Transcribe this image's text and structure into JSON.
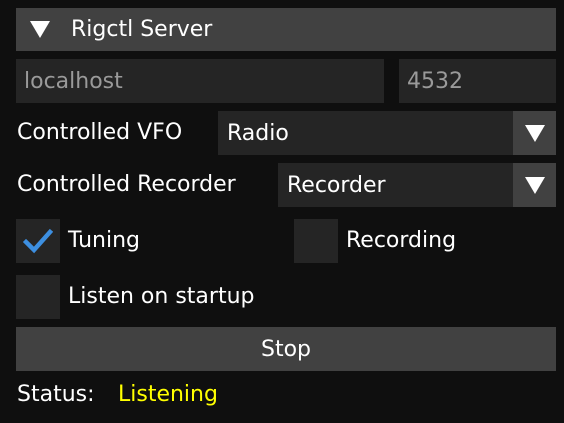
{
  "header": {
    "title": "Rigctl Server"
  },
  "connection": {
    "host_placeholder": "localhost",
    "port_placeholder": "4532"
  },
  "vfo": {
    "label": "Controlled VFO",
    "value": "Radio"
  },
  "recorder": {
    "label": "Controlled Recorder",
    "value": "Recorder"
  },
  "options": {
    "tuning": {
      "label": "Tuning",
      "checked": true
    },
    "recording": {
      "label": "Recording",
      "checked": false
    },
    "listen_on_startup": {
      "label": "Listen on startup",
      "checked": false
    }
  },
  "action": {
    "button_label": "Stop"
  },
  "status": {
    "label": "Status:",
    "value": "Listening"
  },
  "colors": {
    "background": "#0f0f0f",
    "header": "#414141",
    "field": "#252525",
    "check_accent": "#3d8fe0",
    "status_accent": "#ffff00"
  },
  "icons": {
    "header_toggle": "triangle-down-icon",
    "dropdown": "triangle-down-icon",
    "check": "checkmark-icon"
  }
}
